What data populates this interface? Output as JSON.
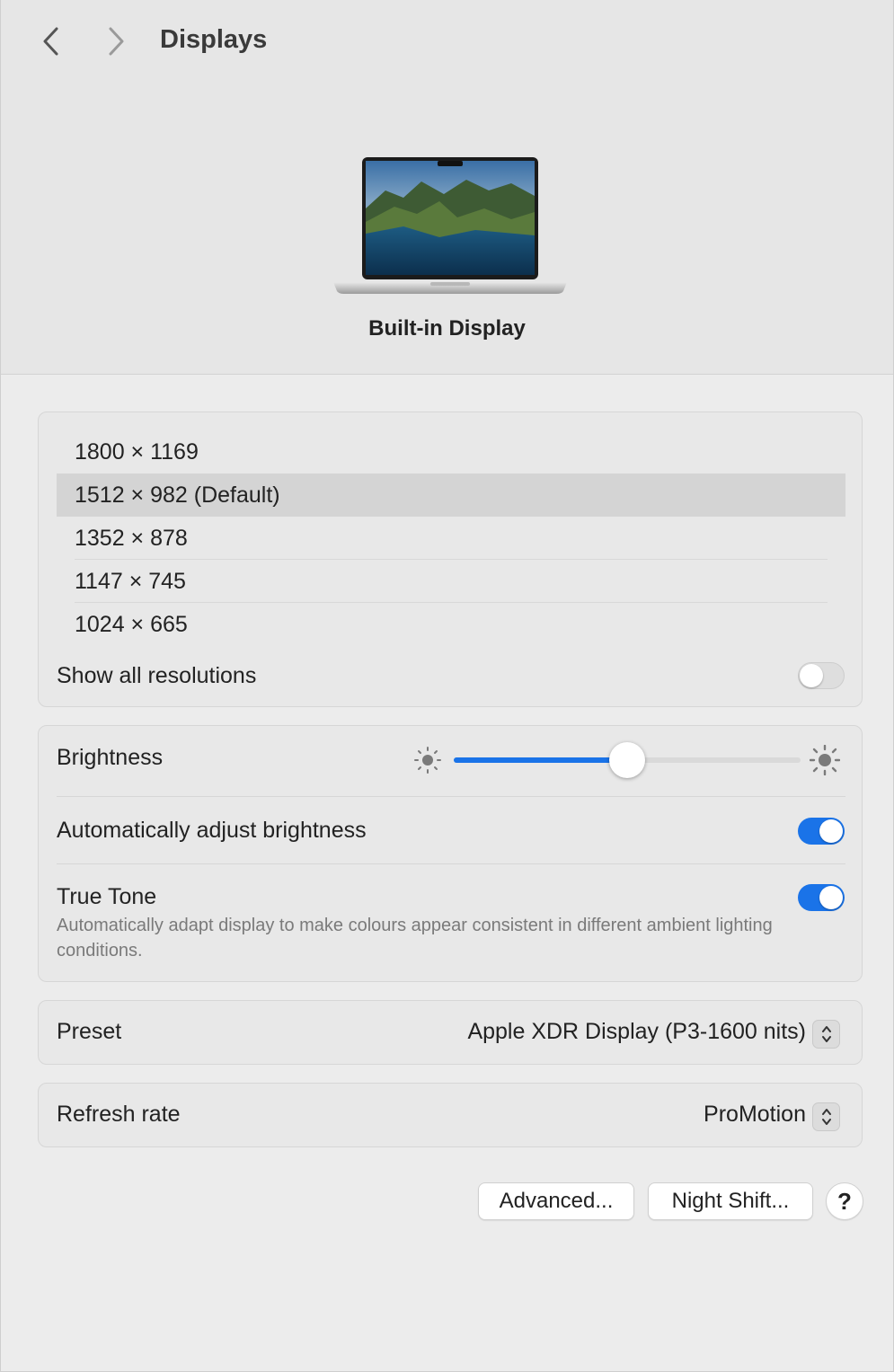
{
  "window": {
    "title": "Displays"
  },
  "display": {
    "name": "Built-in Display"
  },
  "resolutions": {
    "items": [
      {
        "label": "1800 × 1169",
        "selected": false
      },
      {
        "label": "1512 × 982 (Default)",
        "selected": true
      },
      {
        "label": "1352 × 878",
        "selected": false
      },
      {
        "label": "1147 × 745",
        "selected": false
      },
      {
        "label": "1024 × 665",
        "selected": false
      }
    ],
    "show_all_label": "Show all resolutions",
    "show_all_enabled": false
  },
  "brightness": {
    "label": "Brightness",
    "level": 0.5,
    "auto_label": "Automatically adjust brightness",
    "auto_enabled": true,
    "true_tone_label": "True Tone",
    "true_tone_enabled": true,
    "true_tone_description": "Automatically adapt display to make colours appear consistent in different ambient lighting conditions."
  },
  "preset": {
    "label": "Preset",
    "value": "Apple XDR Display (P3-1600 nits)"
  },
  "refresh_rate": {
    "label": "Refresh rate",
    "value": "ProMotion"
  },
  "buttons": {
    "advanced": "Advanced...",
    "night_shift": "Night Shift...",
    "help": "?"
  },
  "colors": {
    "accent": "#1a73e8",
    "selected_row": "#d4d4d4"
  }
}
